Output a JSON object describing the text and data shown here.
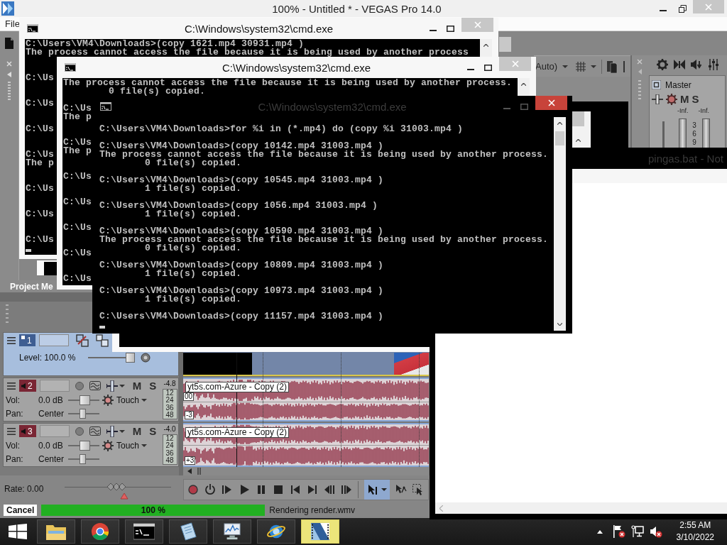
{
  "vegas": {
    "title": "100% - Untitled * - VEGAS Pro 14.0",
    "menu": [
      "File"
    ],
    "preview_quality": "Auto)",
    "master": {
      "name": "Master",
      "mute": "M",
      "solo": "S",
      "peaks": [
        "-Inf.",
        "-Inf."
      ],
      "scale": [
        "3",
        "6",
        "9"
      ]
    },
    "dock_tab": "Project Me",
    "tracks": [
      {
        "kind": "video",
        "number": "1",
        "selected": true,
        "opacity": {
          "text": "Level: 100.0 %",
          "level": 1
        }
      },
      {
        "kind": "audio",
        "number": "2",
        "selected": false,
        "mute": "M",
        "solo": "S",
        "peak": "-4.8",
        "vol": {
          "label": "Vol:",
          "value": "0.0 dB",
          "level": 0.55
        },
        "automation": "Touch",
        "pan": {
          "label": "Pan:",
          "value": "Center",
          "level": 0.45
        },
        "scale": [
          "12",
          "24",
          "36",
          "48"
        ]
      },
      {
        "kind": "audio",
        "number": "3",
        "selected": false,
        "mute": "M",
        "solo": "S",
        "peak": "-4.0",
        "vol": {
          "label": "Vol:",
          "value": "0.0 dB",
          "level": 0.55
        },
        "automation": "Touch",
        "pan": {
          "label": "Pan:",
          "value": "Center",
          "level": 0.45
        },
        "scale": [
          "12",
          "24",
          "36",
          "48"
        ]
      }
    ],
    "events": [
      {
        "name": "yt5s.com-Azure - Copy (2)",
        "markers": [
          {
            "kind": "time",
            "text": "00"
          },
          {
            "kind": "gain",
            "text": "-3"
          }
        ]
      },
      {
        "name": "yt5s.com-Azure - Copy (2)",
        "markers": [
          {
            "kind": "gain",
            "text": "+3"
          }
        ]
      }
    ],
    "rate": {
      "text": "Rate: 0.00",
      "level": 0.5
    },
    "render": {
      "cancel": "Cancel",
      "level": 1,
      "percent": "100 %",
      "status": "Rendering render.wmv"
    }
  },
  "windows": [
    {
      "title": "C:\\Windows\\system32\\cmd.exe",
      "focused": false,
      "cursor": true,
      "blocks": [
        [
          {
            "kind": "command",
            "text": "C:\\Users\\VM4\\Downloads>(copy 1621.mp4 30931.mp4 )"
          },
          {
            "kind": "message",
            "text": "The process cannot access the file because it is being used by another process"
          }
        ],
        [
          {
            "kind": "command",
            "text": "C:\\Us"
          }
        ],
        [
          {
            "kind": "command",
            "text": "C:\\Us"
          }
        ],
        [
          {
            "kind": "command",
            "text": "C:\\Us"
          }
        ],
        [
          {
            "kind": "command",
            "text": "C:\\Us"
          },
          {
            "kind": "message",
            "text": "The p"
          }
        ],
        [
          {
            "kind": "command",
            "text": "C:\\Us"
          }
        ],
        [
          {
            "kind": "command",
            "text": "C:\\Us"
          }
        ],
        [
          {
            "kind": "command",
            "text": "C:\\Us"
          }
        ]
      ]
    },
    {
      "title": "C:\\Windows\\system32\\cmd.exe",
      "focused": false,
      "cursor": false,
      "blocks": [
        [
          {
            "kind": "message",
            "text": "The process cannot access the file because it is being used by another process."
          },
          {
            "kind": "result",
            "text": "0 file(s) copied."
          }
        ],
        [
          {
            "kind": "command",
            "text": "C:\\Us"
          },
          {
            "kind": "message",
            "text": "The p"
          }
        ],
        [
          {
            "kind": "command",
            "text": "C:\\Us"
          },
          {
            "kind": "message",
            "text": "The p"
          }
        ],
        [
          {
            "kind": "command",
            "text": "C:\\Us"
          }
        ],
        [
          {
            "kind": "command",
            "text": "C:\\Us"
          }
        ],
        [
          {
            "kind": "command",
            "text": "C:\\Us"
          }
        ],
        [
          {
            "kind": "command",
            "text": "C:\\Us"
          }
        ],
        [
          {
            "kind": "command",
            "text": "C:\\Us"
          }
        ]
      ]
    },
    {
      "title": "C:\\Windows\\system32\\cmd.exe",
      "focused": true,
      "cursor": true,
      "blocks": [
        [
          {
            "kind": "command",
            "text": "C:\\Users\\VM4\\Downloads>for %i in (*.mp4) do (copy %i 31003.mp4 )"
          }
        ],
        [
          {
            "kind": "command",
            "text": "C:\\Users\\VM4\\Downloads>(copy 10142.mp4 31003.mp4 )"
          },
          {
            "kind": "message",
            "text": "The process cannot access the file because it is being used by another process."
          },
          {
            "kind": "result",
            "text": "0 file(s) copied."
          }
        ],
        [
          {
            "kind": "command",
            "text": "C:\\Users\\VM4\\Downloads>(copy 10545.mp4 31003.mp4 )"
          },
          {
            "kind": "result",
            "text": "1 file(s) copied."
          }
        ],
        [
          {
            "kind": "command",
            "text": "C:\\Users\\VM4\\Downloads>(copy 1056.mp4 31003.mp4 )"
          },
          {
            "kind": "result",
            "text": "1 file(s) copied."
          }
        ],
        [
          {
            "kind": "command",
            "text": "C:\\Users\\VM4\\Downloads>(copy 10590.mp4 31003.mp4 )"
          },
          {
            "kind": "message",
            "text": "The process cannot access the file because it is being used by another process."
          },
          {
            "kind": "result",
            "text": "0 file(s) copied."
          }
        ],
        [
          {
            "kind": "command",
            "text": "C:\\Users\\VM4\\Downloads>(copy 10809.mp4 31003.mp4 )"
          },
          {
            "kind": "result",
            "text": "1 file(s) copied."
          }
        ],
        [
          {
            "kind": "command",
            "text": "C:\\Users\\VM4\\Downloads>(copy 10973.mp4 31003.mp4 )"
          },
          {
            "kind": "result",
            "text": "1 file(s) copied."
          }
        ],
        [
          {
            "kind": "command",
            "text": "C:\\Users\\VM4\\Downloads>(copy 11157.mp4 31003.mp4 )"
          }
        ]
      ]
    }
  ],
  "notepad": {
    "title": "pingas.bat - Not"
  },
  "taskbar": {
    "buttons": [
      {
        "kind": "folder",
        "selected": false
      },
      {
        "kind": "browser",
        "selected": false
      },
      {
        "kind": "console",
        "selected": false
      },
      {
        "kind": "notepad",
        "selected": false
      },
      {
        "kind": "monitor",
        "selected": false
      },
      {
        "kind": "globe",
        "selected": false
      },
      {
        "kind": "editor",
        "selected": true
      }
    ],
    "clock": {
      "time": "2:55 AM",
      "date": "3/10/2022"
    }
  }
}
